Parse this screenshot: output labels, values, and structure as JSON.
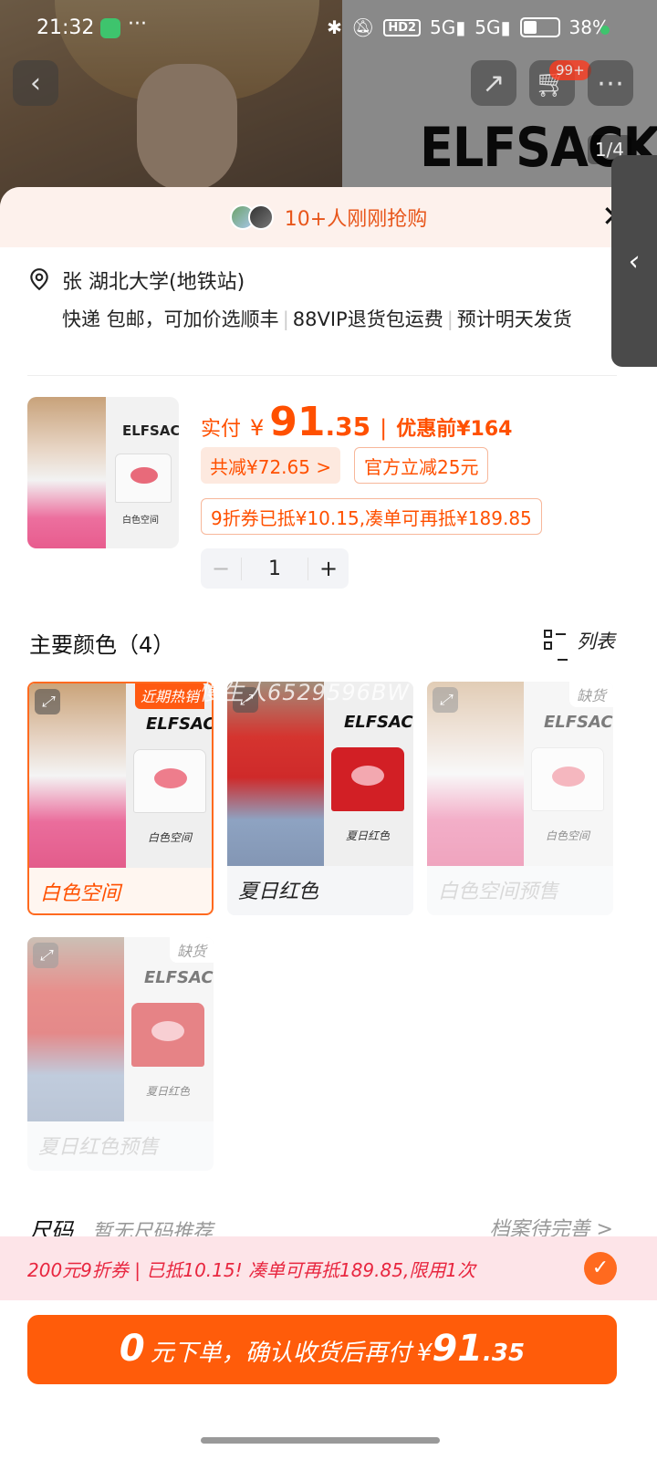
{
  "status_bar": {
    "time": "21:32",
    "battery": "38%",
    "hd_label": "HD2",
    "net1": "5G",
    "net2": "5G"
  },
  "backdrop": {
    "brand": "ELFSACK",
    "cart_badge": "99+",
    "page_indicator": "1/4"
  },
  "sheet": {
    "buyers_banner": "10+人刚刚抢购",
    "address": {
      "line": "张  湖北大学(地铁站)",
      "shipping_parts": [
        "快递 包邮，可加价选顺丰",
        "88VIP退货包运费",
        "预计明天发货"
      ]
    },
    "product": {
      "thumb_brand": "ELFSACK",
      "thumb_caption": "白色空间",
      "paid_label": "实付",
      "currency": "¥",
      "price_int": "91",
      "price_dec": ".35",
      "before_label": "优惠前¥164",
      "savings_chip": "共减¥72.65 >",
      "official_chip": "官方立减25元",
      "coupon_chip": "9折券已抵¥10.15,凑单可再抵¥189.85",
      "quantity": "1",
      "minus": "−",
      "plus": "+"
    },
    "colors": {
      "title": "主要颜色（4）",
      "view_toggle": "列表",
      "watermark": "慢生人6529596BW",
      "items": [
        {
          "label": "白色空间",
          "caption": "白色空间",
          "tag": "近期热销",
          "selected": true
        },
        {
          "label": "夏日红色",
          "caption": "夏日红色",
          "tag": ""
        },
        {
          "label": "白色空间预售",
          "caption": "白色空间",
          "tag": "缺货"
        },
        {
          "label": "夏日红色预售",
          "caption": "夏日红色",
          "tag": "缺货"
        }
      ]
    },
    "size": {
      "title": "尺码",
      "sub": "暂无尺码推荐",
      "right": "档案待完善 >"
    },
    "coupon_bar": "200元9折券 | 已抵10.15! 凑单可再抵189.85,限用1次",
    "order_button": {
      "zero": "0",
      "text": "元下单，确认收货后再付",
      "currency": "¥",
      "int": "91",
      "dec": ".35"
    }
  },
  "colors_theme": {
    "accent": "#ff5000",
    "button": "#ff5c0a",
    "coupon_bg": "#fde4e8",
    "coupon_text": "#e8263f"
  }
}
